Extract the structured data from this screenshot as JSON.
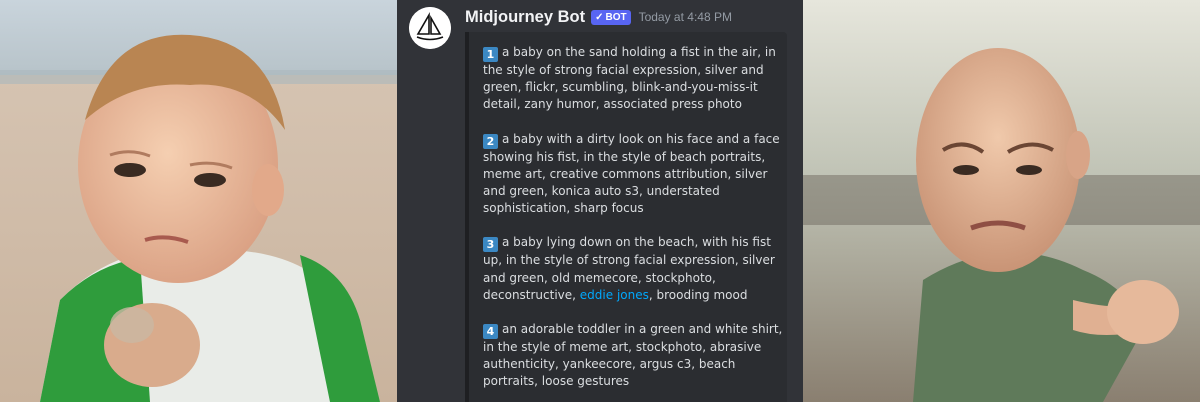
{
  "images": {
    "left": {
      "alt": "baby clenching fist on the beach (original meme photo)"
    },
    "right": {
      "alt": "AI-generated baby pointing fist on the beach"
    }
  },
  "message": {
    "author": "Midjourney Bot",
    "bot_tag": "BOT",
    "bot_check": "✓",
    "timestamp": "Today at 4:48 PM",
    "avatar_icon": "midjourney-sailboat-icon"
  },
  "prompts": [
    {
      "number": "1",
      "text": "a baby on the sand holding a fist in the air, in the style of strong facial expression, silver and green, flickr, scumbling, blink-and-you-miss-it detail, zany humor, associated press photo"
    },
    {
      "number": "2",
      "text": "a baby with a dirty look on his face and a face showing his fist, in the style of beach portraits, meme art, creative commons attribution, silver and green, konica auto s3, understated sophistication, sharp focus"
    },
    {
      "number": "3",
      "text_before": "a baby lying down on the beach, with his fist up, in the style of strong facial expression, silver and green, old memecore, stockphoto, deconstructive, ",
      "link": "eddie jones",
      "text_after": ", brooding mood"
    },
    {
      "number": "4",
      "text": "an adorable toddler in a green and white shirt, in the style of meme art, stockphoto, abrasive authenticity, yankeecore, argus c3, beach portraits, loose gestures"
    }
  ],
  "colors": {
    "background": "#313338",
    "embed": "#2b2d31",
    "bot_tag": "#5865f2",
    "number_badge": "#3b88c3",
    "link": "#00a8fc"
  }
}
